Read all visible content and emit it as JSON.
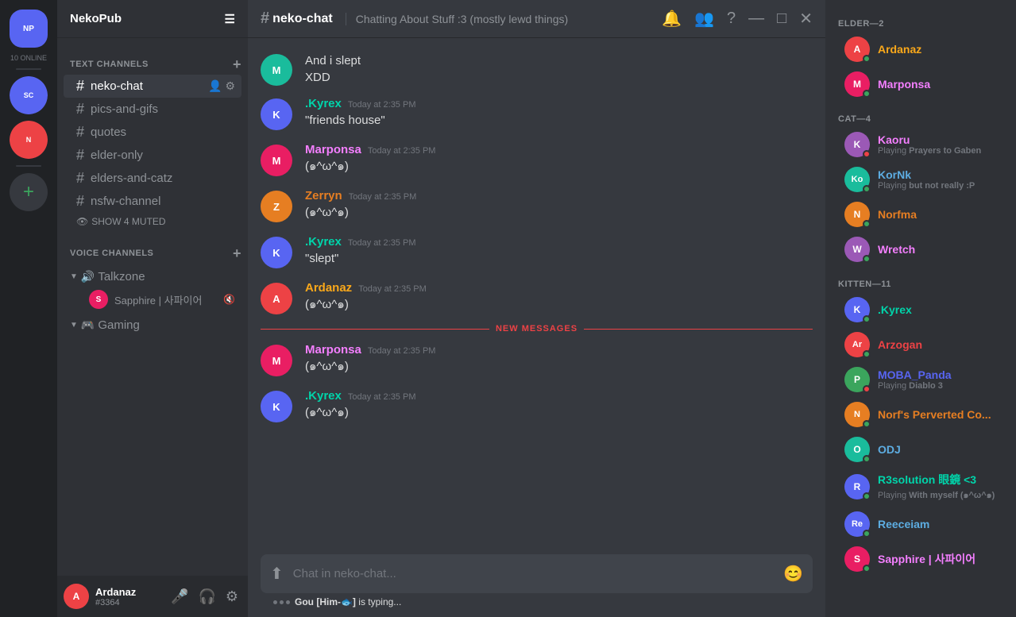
{
  "server": {
    "name": "NekoPub",
    "online_count": "10 ONLINE"
  },
  "channels": {
    "text_section_label": "TEXT CHANNELS",
    "voice_section_label": "VOICE CHANNELS",
    "active_channel": "neko-chat",
    "text_channels": [
      {
        "name": "neko-chat",
        "active": true
      },
      {
        "name": "pics-and-gifs"
      },
      {
        "name": "quotes"
      },
      {
        "name": "elder-only"
      },
      {
        "name": "elders-and-catz"
      },
      {
        "name": "nsfw-channel"
      }
    ],
    "muted_label": "SHOW 4 MUTED",
    "voice_channels": [
      {
        "name": "Talkzone",
        "users": [
          {
            "name": "Sapphire | 사파이어",
            "muted": true
          }
        ]
      },
      {
        "name": "Gaming",
        "users": []
      }
    ]
  },
  "chat": {
    "channel_name": "neko-chat",
    "channel_hash": "#",
    "topic": "Chatting About Stuff :3 (mostly lewd things)",
    "messages": [
      {
        "id": 1,
        "author": "",
        "avatar_color": "av-teal",
        "avatar_initial": "M",
        "show_header": false,
        "text": "And i slept\nXDD"
      },
      {
        "id": 2,
        "author": ".Kyrex",
        "author_color": "color-teal",
        "avatar_color": "av-blue",
        "avatar_initial": "K",
        "time": "Today at 2:35 PM",
        "text": "\"friends house\""
      },
      {
        "id": 3,
        "author": "Marponsa",
        "author_color": "color-pink",
        "avatar_color": "av-pink",
        "avatar_initial": "M",
        "time": "Today at 2:35 PM",
        "text": "(๑^ω^๑)"
      },
      {
        "id": 4,
        "author": "Zerryn",
        "author_color": "color-orange",
        "avatar_color": "av-orange",
        "avatar_initial": "Z",
        "time": "Today at 2:35 PM",
        "text": "(๑^ω^๑)"
      },
      {
        "id": 5,
        "author": ".Kyrex",
        "author_color": "color-teal",
        "avatar_color": "av-blue",
        "avatar_initial": "K",
        "time": "Today at 2:35 PM",
        "text": "\"slept\""
      },
      {
        "id": 6,
        "author": "Ardanaz",
        "author_color": "color-yellow",
        "avatar_color": "av-red",
        "avatar_initial": "A",
        "time": "Today at 2:35 PM",
        "text": "(๑^ω^๑)"
      },
      {
        "divider": true,
        "label": "NEW MESSAGES"
      },
      {
        "id": 7,
        "author": "Marponsa",
        "author_color": "color-pink",
        "avatar_color": "av-pink",
        "avatar_initial": "M",
        "time": "Today at 2:35 PM",
        "text": "(๑^ω^๑)"
      },
      {
        "id": 8,
        "author": ".Kyrex",
        "author_color": "color-teal",
        "avatar_color": "av-blue",
        "avatar_initial": "K",
        "time": "Today at 2:35 PM",
        "text": "(๑^ω^๑)"
      }
    ],
    "input_placeholder": "Chat in neko-chat...",
    "typing_user": "Gou [Him-🐟]",
    "typing_suffix": " is typing..."
  },
  "members": {
    "sections": [
      {
        "label": "ELDER—2",
        "members": [
          {
            "name": "Ardanaz",
            "color": "color-yellow",
            "status": "online",
            "avatar_color": "av-red",
            "initial": "A"
          },
          {
            "name": "Marponsa",
            "color": "color-pink",
            "status": "online",
            "avatar_color": "av-pink",
            "initial": "M"
          }
        ]
      },
      {
        "label": "CAT—4",
        "members": [
          {
            "name": "Kaoru",
            "color": "color-pink",
            "status": "dnd",
            "avatar_color": "av-purple",
            "initial": "K",
            "activity": "Playing ",
            "activity_bold": "Prayers to Gaben"
          },
          {
            "name": "KorNk",
            "color": "color-light-blue",
            "status": "online",
            "avatar_color": "av-teal",
            "initial": "Ko",
            "activity": "Playing ",
            "activity_bold": "but not really :P"
          },
          {
            "name": "Norfma",
            "color": "color-orange",
            "status": "online",
            "avatar_color": "av-orange",
            "initial": "N"
          },
          {
            "name": "Wretch",
            "color": "color-pink",
            "status": "online",
            "avatar_color": "av-purple",
            "initial": "W"
          }
        ]
      },
      {
        "label": "KITTEN—11",
        "members": [
          {
            "name": ".Kyrex",
            "color": "color-teal",
            "status": "online",
            "avatar_color": "av-blue",
            "initial": "K"
          },
          {
            "name": "Arzogan",
            "color": "color-red",
            "status": "online",
            "avatar_color": "av-red",
            "initial": "Ar"
          },
          {
            "name": "MOBA_Panda",
            "color": "color-blue",
            "status": "dnd",
            "avatar_color": "av-green",
            "initial": "P",
            "activity": "Playing ",
            "activity_bold": "Diablo 3"
          },
          {
            "name": "Norf's Perverted Co...",
            "color": "color-orange",
            "status": "online",
            "avatar_color": "av-orange",
            "initial": "N"
          },
          {
            "name": "ODJ",
            "color": "color-light-blue",
            "status": "online",
            "avatar_color": "av-teal",
            "initial": "O"
          },
          {
            "name": "R3solution 眼鏡 <3",
            "color": "color-teal",
            "status": "online",
            "avatar_color": "av-blue",
            "initial": "R",
            "activity": "Playing ",
            "activity_bold": "With myself (๑^ω^๑)"
          },
          {
            "name": "Reeceiam",
            "color": "color-light-blue",
            "status": "online",
            "avatar_color": "av-blue",
            "initial": "Re"
          },
          {
            "name": "Sapphire | 사파이어",
            "color": "color-pink",
            "status": "online",
            "avatar_color": "av-pink",
            "initial": "S"
          }
        ]
      }
    ]
  },
  "user": {
    "name": "Ardanaz",
    "tag": "#3364",
    "avatar_color": "av-red",
    "avatar_initial": "A"
  },
  "icons": {
    "hamburger": "☰",
    "bell": "🔔",
    "people": "👥",
    "question": "?",
    "minimize": "—",
    "maximize": "□",
    "close": "✕",
    "hash": "#",
    "plus": "+",
    "down_arrow": "▼",
    "right_arrow": "▶",
    "mic": "🎤",
    "headphone": "🎧",
    "gear": "⚙",
    "upload": "⬆",
    "smile": "😊",
    "muted_icon": "🔇",
    "pin": "📌",
    "invite": "👤"
  }
}
